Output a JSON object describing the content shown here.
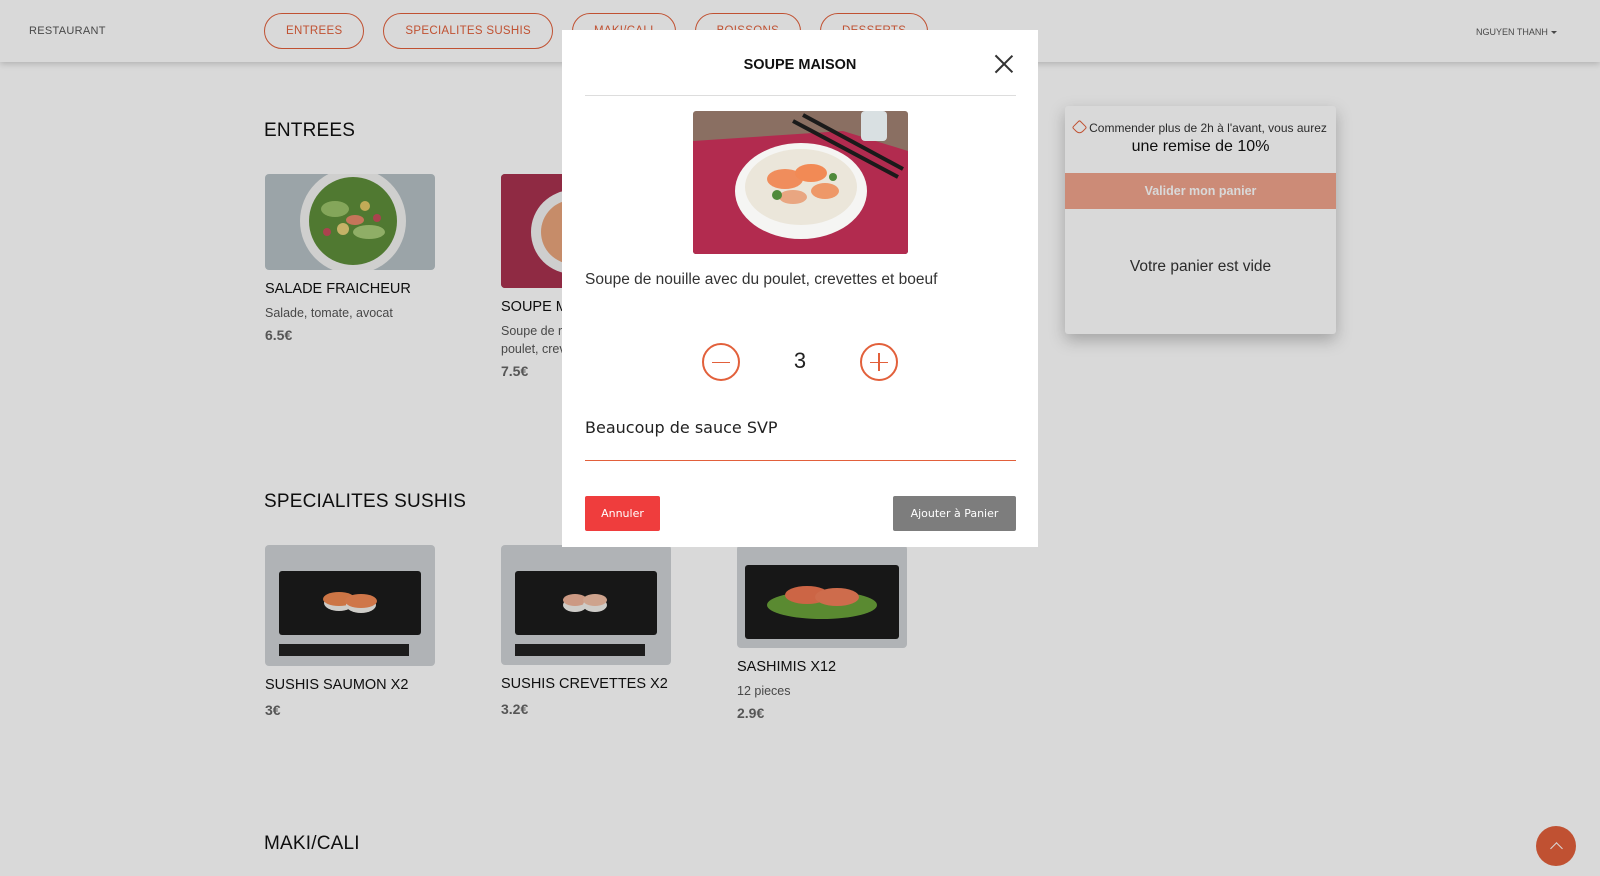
{
  "navbar": {
    "brand": "RESTAURANT",
    "tabs": [
      "ENTREES",
      "SPECIALITES SUSHIS",
      "MAKI/CALI",
      "BOISSONS",
      "DESSERTS"
    ],
    "user": "NGUYEN THANH"
  },
  "sections": {
    "entrees": {
      "title": "ENTREES",
      "items": [
        {
          "name": "SALADE FRAICHEUR",
          "desc": "Salade, tomate, avocat",
          "price": "6.5€"
        },
        {
          "name": "SOUPE M",
          "desc_line1": "Soupe de r",
          "desc_line2": "poulet, crev",
          "price": "7.5€"
        }
      ]
    },
    "sushis": {
      "title": "SPECIALITES SUSHIS",
      "items": [
        {
          "name": "SUSHIS SAUMON X2",
          "price": "3€"
        },
        {
          "name": "SUSHIS CREVETTES X2",
          "price": "3.2€"
        },
        {
          "name": "SASHIMIS X12",
          "desc": "12 pieces",
          "price": "2.9€"
        }
      ]
    },
    "maki": {
      "title": "MAKI/CALI"
    }
  },
  "cart": {
    "promo": "Commender plus de 2h à l'avant, vous aurez",
    "discount": "une remise de 10%",
    "validate_label": "Valider mon panier",
    "empty_text": "Votre panier est vide"
  },
  "modal": {
    "title": "SOUPE MAISON",
    "description": "Soupe de nouille avec du poulet, crevettes et boeuf",
    "quantity": "3",
    "note_value": "Beaucoup de sauce SVP",
    "cancel_label": "Annuler",
    "add_label": "Ajouter à Panier"
  },
  "colors": {
    "accent": "#e2603b",
    "cancel": "#ef3d3d",
    "add": "#7d7d7d",
    "validate": "#f0a48c"
  },
  "icons": {
    "close": "close-icon",
    "minus": "minus-icon",
    "plus": "plus-icon",
    "tag": "tag-icon",
    "scroll_top": "chevron-up-icon"
  }
}
